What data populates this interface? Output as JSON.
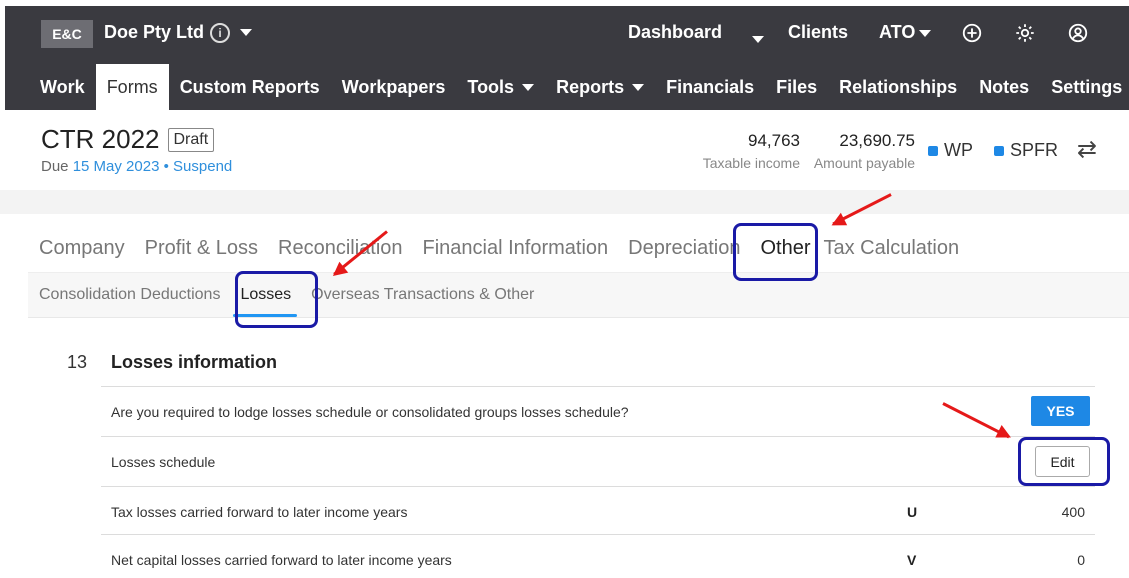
{
  "topbar": {
    "logo": "E&C",
    "company": "Doe Pty Ltd",
    "info_icon": "info-icon",
    "dashboard": "Dashboard",
    "clients": "Clients",
    "ato": "ATO",
    "icons": [
      "plus-circle-icon",
      "gear-icon",
      "user-circle-icon"
    ]
  },
  "menu": {
    "items": [
      {
        "label": "Work"
      },
      {
        "label": "Forms"
      },
      {
        "label": "Custom Reports"
      },
      {
        "label": "Workpapers"
      },
      {
        "label": "Tools"
      },
      {
        "label": "Reports"
      },
      {
        "label": "Financials"
      },
      {
        "label": "Files"
      },
      {
        "label": "Relationships"
      },
      {
        "label": "Notes"
      },
      {
        "label": "Settings"
      }
    ],
    "active": "Forms"
  },
  "header": {
    "title": "CTR 2022",
    "badge": "Draft",
    "due_prefix": "Due",
    "due_date": "15 May 2023",
    "separator": "•",
    "suspend": "Suspend",
    "taxable_income_value": "94,763",
    "taxable_income_label": "Taxable income",
    "amount_payable_value": "23,690.75",
    "amount_payable_label": "Amount payable",
    "legend_wp": "WP",
    "legend_spfr": "SPFR",
    "legend_color": "#1e88e5",
    "swap_icon": "swap-arrows-icon"
  },
  "tabs": {
    "items": [
      {
        "label": "Company"
      },
      {
        "label": "Profit & Loss"
      },
      {
        "label": "Reconciliation"
      },
      {
        "label": "Financial Information"
      },
      {
        "label": "Depreciation"
      },
      {
        "label": "Other"
      },
      {
        "label": "Tax Calculation"
      }
    ],
    "active": "Other"
  },
  "subtabs": {
    "items": [
      {
        "label": "Consolidation Deductions"
      },
      {
        "label": "Losses"
      },
      {
        "label": "Overseas Transactions & Other"
      }
    ],
    "active": "Losses"
  },
  "section": {
    "number": "13",
    "title": "Losses information",
    "rows": [
      {
        "label": "Are you required to lodge losses schedule or consolidated groups losses schedule?",
        "code": "",
        "value": "YES"
      },
      {
        "label": "Losses schedule",
        "code": "",
        "value": "Edit"
      },
      {
        "label": "Tax losses carried forward to later income years",
        "code": "U",
        "value": "400"
      },
      {
        "label": "Net capital losses carried forward to later income years",
        "code": "V",
        "value": "0"
      }
    ]
  },
  "colors": {
    "nav_bg": "#3a3a40",
    "accent": "#2196f3",
    "annotation_box": "#1a1aa6",
    "annotation_arrow": "#e51919"
  }
}
